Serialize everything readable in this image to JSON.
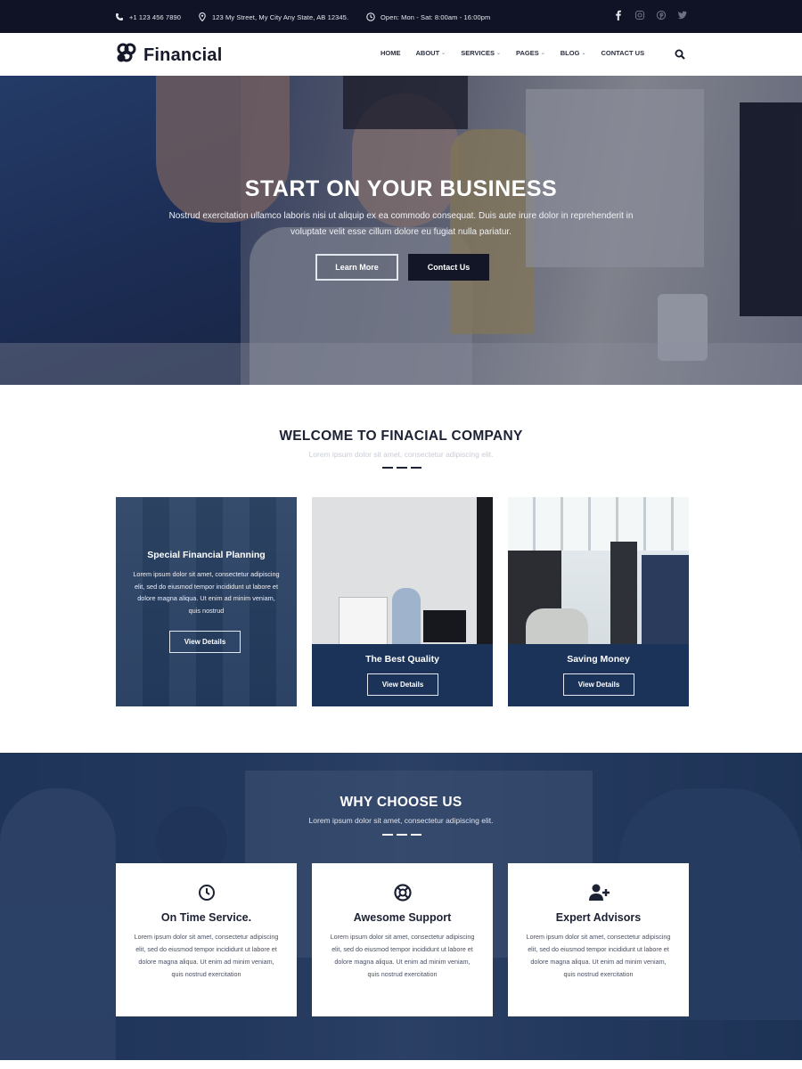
{
  "topbar": {
    "phone": "+1 123 456 7890",
    "address": "123 My Street, My City Any State, AB 12345.",
    "hours": "Open: Mon - Sat: 8:00am - 16:00pm",
    "icons": [
      "phone-icon",
      "map-pin-icon",
      "clock-icon"
    ],
    "social": [
      "facebook-icon",
      "instagram-icon",
      "pinterest-icon",
      "twitter-icon"
    ]
  },
  "nav": {
    "logo": "Financial",
    "items": [
      {
        "label": "HOME",
        "dropdown": false
      },
      {
        "label": "ABOUT",
        "dropdown": true
      },
      {
        "label": "SERVICES",
        "dropdown": true
      },
      {
        "label": "PAGES",
        "dropdown": true
      },
      {
        "label": "BLOG",
        "dropdown": true
      },
      {
        "label": "CONTACT US",
        "dropdown": false
      }
    ],
    "search_icon": "search-icon"
  },
  "hero": {
    "title": "START ON YOUR BUSINESS",
    "text": "Nostrud exercitation ullamco laboris nisi ut aliquip ex ea commodo consequat. Duis aute irure dolor in reprehenderit in voluptate velit esse cillum dolore eu fugiat nulla pariatur.",
    "btn_learn": "Learn More",
    "btn_contact": "Contact Us"
  },
  "welcome": {
    "title": "WELCOME TO FINACIAL COMPANY",
    "subtitle": "Lorem ipsum dolor sit amet, consectetur adipiscing elit.",
    "cards": [
      {
        "title": "Special Financial Planning",
        "text": "Lorem ipsum dolor sit amet, consectetur adipiscing elit, sed do eiusmod tempor incididunt ut labore et dolore magna aliqua. Ut enim ad minim veniam, quis nostrud",
        "button": "View Details"
      },
      {
        "title": "The Best Quality",
        "button": "View Details"
      },
      {
        "title": "Saving Money",
        "button": "View Details"
      }
    ]
  },
  "why": {
    "title": "WHY CHOOSE US",
    "subtitle": "Lorem ipsum dolor sit amet, consectetur adipiscing elit.",
    "features": [
      {
        "icon": "clock-icon",
        "title": "On Time Service.",
        "text": "Lorem ipsum dolor sit amet, consectetur adipiscing elit, sed do eiusmod tempor incididunt ut labore et dolore magna aliqua. Ut enim ad minim veniam, quis nostrud exercitation"
      },
      {
        "icon": "life-ring-icon",
        "title": "Awesome Support",
        "text": "Lorem ipsum dolor sit amet, consectetur adipiscing elit, sed do eiusmod tempor incididunt ut labore et dolore magna aliqua. Ut enim ad minim veniam, quis nostrud exercitation"
      },
      {
        "icon": "user-plus-icon",
        "title": "Expert Advisors",
        "text": "Lorem ipsum dolor sit amet, consectetur adipiscing elit, sed do eiusmod tempor incididunt ut labore et dolore magna aliqua. Ut enim ad minim veniam, quis nostrud exercitation"
      }
    ]
  },
  "colors": {
    "topbar_bg": "#0f1325",
    "navy": "#1b3358",
    "dark_button": "#121626",
    "text_dark": "#1c2233",
    "subtitle_light": "#c9cdd8"
  }
}
